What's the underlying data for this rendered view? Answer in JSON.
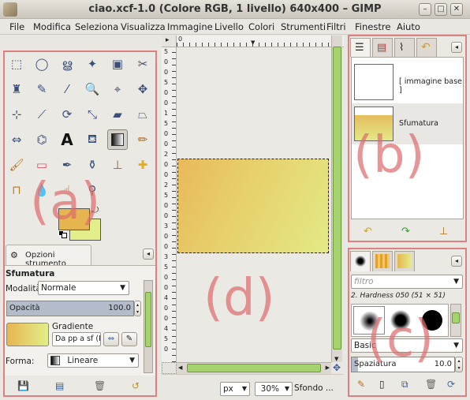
{
  "window": {
    "title": "ciao.xcf-1.0 (Colore RGB, 1 livello) 640x400 – GIMP"
  },
  "menubar": [
    "File",
    "Modifica",
    "Seleziona",
    "Visualizza",
    "Immagine",
    "Livello",
    "Colori",
    "Strumenti",
    "Filtri",
    "Finestre",
    "Aiuto"
  ],
  "annotations": {
    "a": "(a)",
    "b": "(b)",
    "c": "(c)",
    "d": "(d)"
  },
  "tool_options": {
    "tab_label": "Opzioni strumento",
    "title": "Sfumatura",
    "mode_label": "Modalità:",
    "mode_value": "Normale",
    "opacity_label": "Opacità",
    "opacity_value": "100.0",
    "opacity_fraction": 1.0,
    "gradient_label": "Gradiente",
    "gradient_value": "Da pp a sf (R",
    "shape_label": "Forma:",
    "shape_value": "Lineare"
  },
  "layers": [
    {
      "name": "[ immagine base ]"
    },
    {
      "name": "Sfumatura"
    }
  ],
  "ruler": {
    "h_label": "0",
    "v_labels": [
      "5",
      "0",
      "0",
      "5",
      "0",
      "0",
      "1",
      "5",
      "0",
      "0",
      "2",
      "0",
      "0",
      "2",
      "5",
      "0",
      "0",
      "3",
      "0",
      "0",
      "3",
      "5",
      "0",
      "0",
      "4",
      "0",
      "0",
      "4",
      "5",
      "0"
    ]
  },
  "statusbar": {
    "unit": "px",
    "zoom": "30%",
    "layer": "Sfondo ..."
  },
  "brushes": {
    "filter_placeholder": "filtro",
    "current_brush": "2. Hardness 050 (51 × 51)",
    "set": "Basic",
    "spacing_label": "Spaziatura",
    "spacing_value": "10.0"
  }
}
